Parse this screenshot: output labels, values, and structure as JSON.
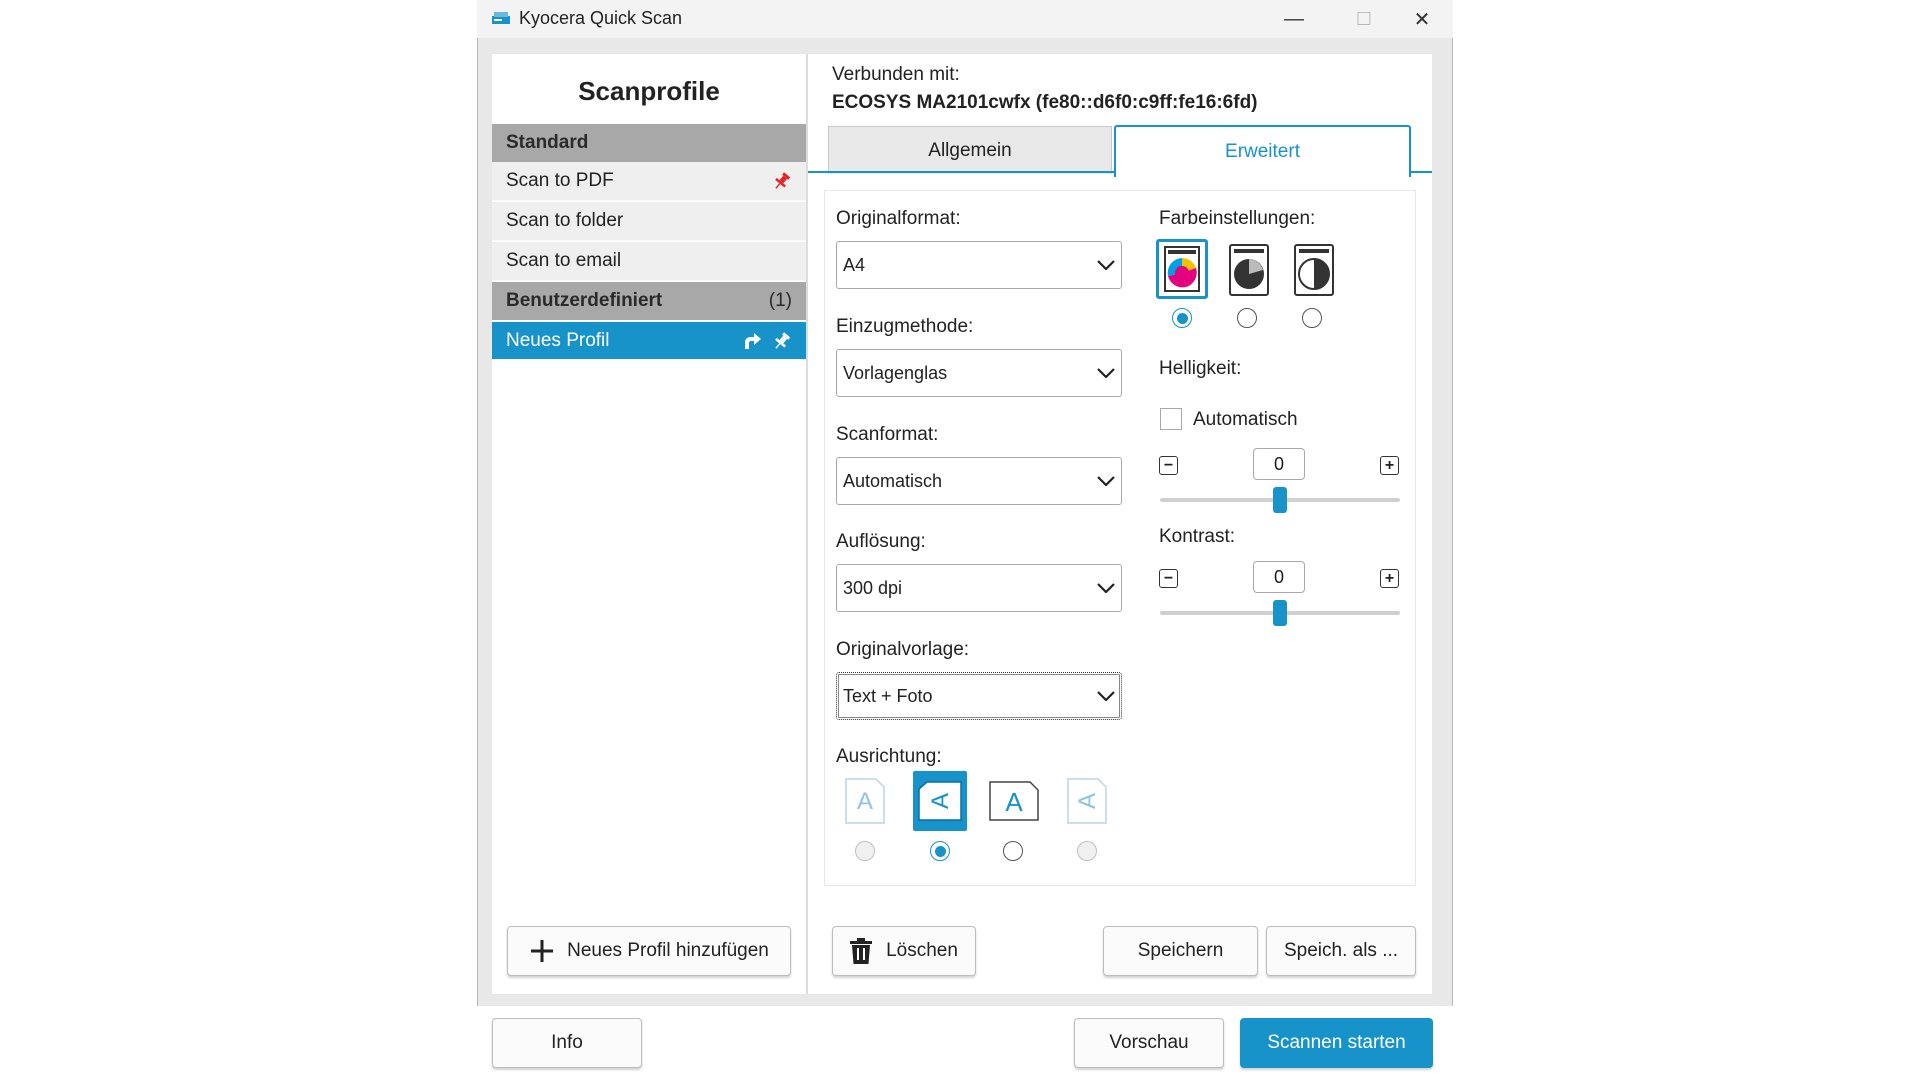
{
  "window": {
    "title": "Kyocera Quick Scan",
    "minimize": "—",
    "maximize": "☐",
    "close": "✕"
  },
  "left": {
    "title": "Scanprofile",
    "standard_header": "Standard",
    "standard_items": [
      "Scan to PDF",
      "Scan to folder",
      "Scan to email"
    ],
    "custom_header": "Benutzerdefiniert",
    "custom_count": "(1)",
    "custom_items": [
      "Neues Profil"
    ],
    "add_button": "Neues Profil hinzufügen"
  },
  "connection": {
    "label": "Verbunden mit:",
    "device": "ECOSYS MA2101cwfx (fe80::d6f0:c9ff:fe16:6fd)"
  },
  "tabs": [
    "Allgemein",
    "Erweitert"
  ],
  "active_tab": "Erweitert",
  "fields": {
    "originalformat": {
      "label": "Originalformat:",
      "value": "A4"
    },
    "einzugmethode": {
      "label": "Einzugmethode:",
      "value": "Vorlagenglas"
    },
    "scanformat": {
      "label": "Scanformat:",
      "value": "Automatisch"
    },
    "aufloesung": {
      "label": "Auflösung:",
      "value": "300 dpi"
    },
    "originalvorlage": {
      "label": "Originalvorlage:",
      "value": "Text + Foto"
    },
    "ausrichtung": {
      "label": "Ausrichtung:",
      "selected_index": 1
    }
  },
  "color": {
    "label": "Farbeinstellungen:",
    "options": [
      "color-icon",
      "grayscale-icon",
      "black-white-icon"
    ],
    "selected_index": 0
  },
  "helligkeit": {
    "label": "Helligkeit:",
    "auto_label": "Automatisch",
    "auto_checked": false,
    "value": "0",
    "minus": "−",
    "plus": "+",
    "slider_fraction": 0.5
  },
  "kontrast": {
    "label": "Kontrast:",
    "value": "0",
    "minus": "−",
    "plus": "+",
    "slider_fraction": 0.5
  },
  "actions": {
    "delete": "Löschen",
    "save": "Speichern",
    "save_as": "Speich. als ..."
  },
  "footer": {
    "info": "Info",
    "preview": "Vorschau",
    "start": "Scannen starten"
  },
  "colors": {
    "accent": "#1793c9",
    "pin_red": "#e0262b"
  }
}
